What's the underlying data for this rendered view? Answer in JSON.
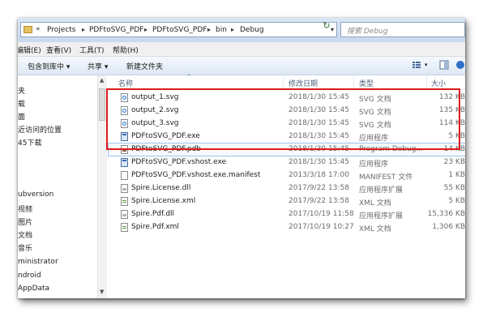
{
  "address": {
    "prefix": "«",
    "crumbs": [
      "Projects",
      "PDFtoSVG_PDF",
      "PDFtoSVG_PDF",
      "bin",
      "Debug"
    ],
    "search_placeholder": "搜索 Debug"
  },
  "menu": [
    "编辑(E)",
    "查看(V)",
    "工具(T)",
    "帮助(H)"
  ],
  "toolbar": {
    "include_library": "包含到库中 ▾",
    "share": "共享 ▾",
    "new_folder": "新建文件夹"
  },
  "nav": [
    "夹",
    "载",
    "面",
    "近访问的位置",
    "45下载",
    "ubversion",
    "视频",
    "图片",
    "文档",
    "音乐",
    "ministrator",
    "ndroid",
    "AppData"
  ],
  "columns": {
    "name": "名称",
    "date": "修改日期",
    "type": "类型",
    "size": "大小"
  },
  "files": [
    {
      "name": "output_1.svg",
      "date": "2018/1/30 15:45",
      "type": "SVG 文档",
      "size": "132 KB",
      "icon": "svg"
    },
    {
      "name": "output_2.svg",
      "date": "2018/1/30 15:45",
      "type": "SVG 文档",
      "size": "135 KB",
      "icon": "svg"
    },
    {
      "name": "output_3.svg",
      "date": "2018/1/30 15:45",
      "type": "SVG 文档",
      "size": "114 KB",
      "icon": "svg"
    },
    {
      "name": "PDFtoSVG_PDF.exe",
      "date": "2018/1/30 15:45",
      "type": "应用程序",
      "size": "5 KB",
      "icon": "exe"
    },
    {
      "name": "PDFtoSVG_PDF.pdb",
      "date": "2018/1/30 15:45",
      "type": "Program Debug...",
      "size": "14 KB",
      "icon": "pdb"
    },
    {
      "name": "PDFtoSVG_PDF.vshost.exe",
      "date": "2018/1/30 15:45",
      "type": "应用程序",
      "size": "23 KB",
      "icon": "exe"
    },
    {
      "name": "PDFtoSVG_PDF.vshost.exe.manifest",
      "date": "2013/3/18 17:00",
      "type": "MANIFEST 文件",
      "size": "1 KB",
      "icon": "file"
    },
    {
      "name": "Spire.License.dll",
      "date": "2017/9/22 13:58",
      "type": "应用程序扩展",
      "size": "55 KB",
      "icon": "dll"
    },
    {
      "name": "Spire.License.xml",
      "date": "2017/9/22 13:58",
      "type": "XML 文档",
      "size": "5 KB",
      "icon": "xml"
    },
    {
      "name": "Spire.Pdf.dll",
      "date": "2017/10/19 11:58",
      "type": "应用程序扩展",
      "size": "15,336 KB",
      "icon": "dll"
    },
    {
      "name": "Spire.Pdf.xml",
      "date": "2017/10/19 10:27",
      "type": "XML 文档",
      "size": "1,306 KB",
      "icon": "xml"
    }
  ],
  "colors": {
    "highlight_box": "#e01a1a",
    "selection_outline": "#9ec3ea"
  }
}
